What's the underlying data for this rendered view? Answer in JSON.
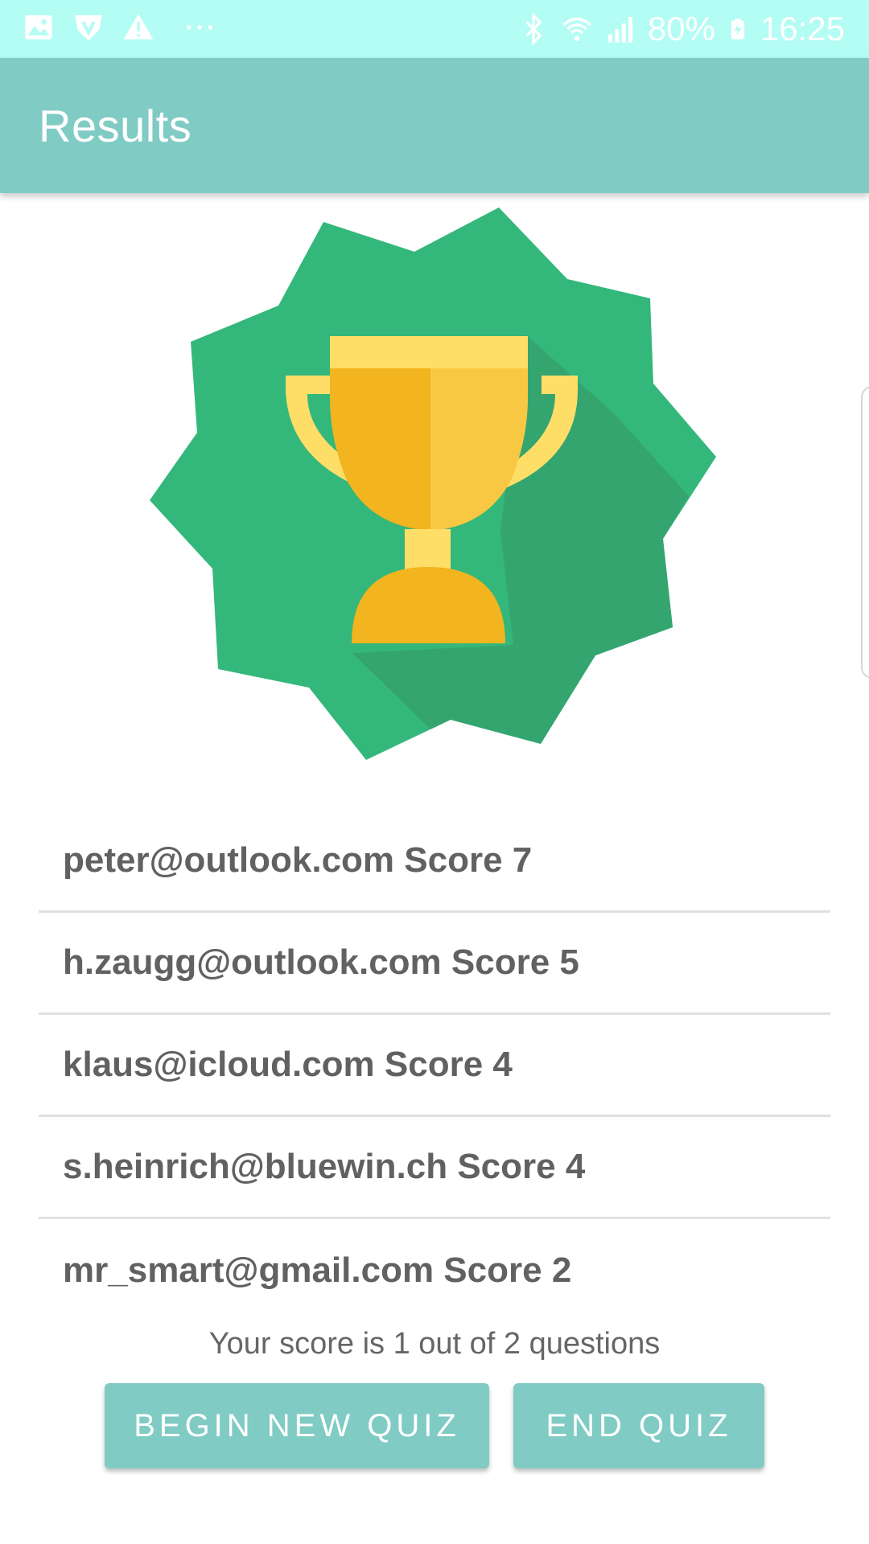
{
  "status_bar": {
    "left_icons": [
      "image-icon",
      "shield-icon",
      "warning-icon",
      "more-icon"
    ],
    "right_icons": [
      "bluetooth-icon",
      "wifi-icon",
      "signal-icon",
      "battery-charging-icon"
    ],
    "battery": "80%",
    "time": "16:25"
  },
  "app_bar": {
    "title": "Results"
  },
  "scores": [
    {
      "text": "peter@outlook.com Score 7"
    },
    {
      "text": "h.zaugg@outlook.com Score 5"
    },
    {
      "text": "klaus@icloud.com Score 4"
    },
    {
      "text": "s.heinrich@bluewin.ch Score 4"
    },
    {
      "text": "mr_smart@gmail.com Score 2"
    }
  ],
  "summary": "Your score is 1 out of 2 questions",
  "buttons": {
    "begin": "BEGIN NEW QUIZ",
    "end": "END QUIZ"
  },
  "colors": {
    "status_bar": "#b3fdf4",
    "app_bar": "#80cbc4",
    "badge_green": "#34b77b",
    "trophy_gold": "#f2b41f",
    "trophy_light": "#ffde68"
  }
}
